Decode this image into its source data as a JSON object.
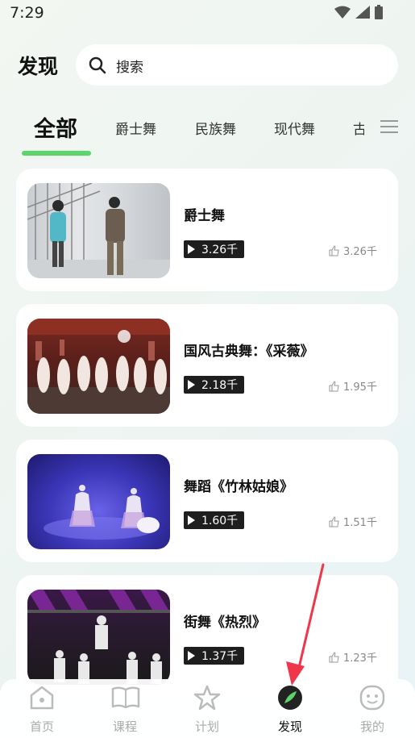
{
  "status_bar": {
    "time": "7:29"
  },
  "header": {
    "title": "发现",
    "search_placeholder": "搜索"
  },
  "tabs": {
    "active": "全部",
    "items": [
      "爵士舞",
      "民族舞",
      "现代舞",
      "古"
    ]
  },
  "videos": [
    {
      "title": "爵士舞",
      "plays": "3.26千",
      "likes": "3.26千"
    },
    {
      "title": "国风古典舞：《采薇》",
      "plays": "2.18千",
      "likes": "1.95千"
    },
    {
      "title": "舞蹈《竹林姑娘》",
      "plays": "1.60千",
      "likes": "1.51千"
    },
    {
      "title": "街舞《热烈》",
      "plays": "1.37千",
      "likes": "1.23千"
    }
  ],
  "bottom_nav": [
    {
      "label": "首页",
      "icon": "home-icon"
    },
    {
      "label": "课程",
      "icon": "book-icon"
    },
    {
      "label": "计划",
      "icon": "star-icon"
    },
    {
      "label": "发现",
      "icon": "discover-icon",
      "active": true
    },
    {
      "label": "我的",
      "icon": "profile-icon"
    }
  ],
  "colors": {
    "accent": "#5cd66b",
    "annotation_arrow": "#f0364a"
  }
}
